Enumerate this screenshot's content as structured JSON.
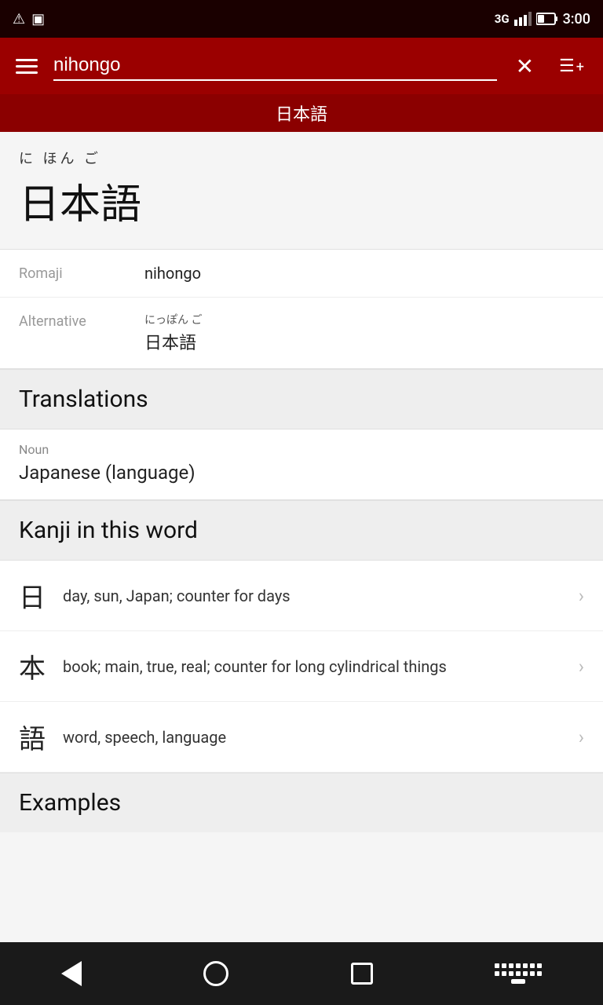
{
  "statusBar": {
    "leftIcons": [
      "warning-icon",
      "sim-icon"
    ],
    "network": "3G",
    "time": "3:00"
  },
  "appBar": {
    "searchValue": "nihongo",
    "searchPlaceholder": "Search...",
    "closeLabel": "×",
    "addLabel": "≡+"
  },
  "subtitleBar": {
    "text": "日本語"
  },
  "wordHeader": {
    "furigana": "に  ほん  ご",
    "kanji": "日本語"
  },
  "details": [
    {
      "label": "Romaji",
      "value": "nihongo",
      "hasSubtext": false
    },
    {
      "label": "Alternative",
      "subtext": "にっぽん ご",
      "value": "日本語",
      "hasSubtext": true
    }
  ],
  "sections": {
    "translations": {
      "title": "Translations",
      "items": [
        {
          "partOfSpeech": "Noun",
          "translation": "Japanese (language)"
        }
      ]
    },
    "kanji": {
      "title": "Kanji in this word",
      "items": [
        {
          "char": "日",
          "description": "day, sun, Japan; counter for days"
        },
        {
          "char": "本",
          "description": "book; main, true, real; counter for long cylindrical things"
        },
        {
          "char": "語",
          "description": "word, speech, language"
        }
      ]
    },
    "examples": {
      "title": "Examples"
    }
  },
  "navBar": {
    "back": "back",
    "home": "home",
    "recents": "recents",
    "keyboard": "keyboard"
  }
}
